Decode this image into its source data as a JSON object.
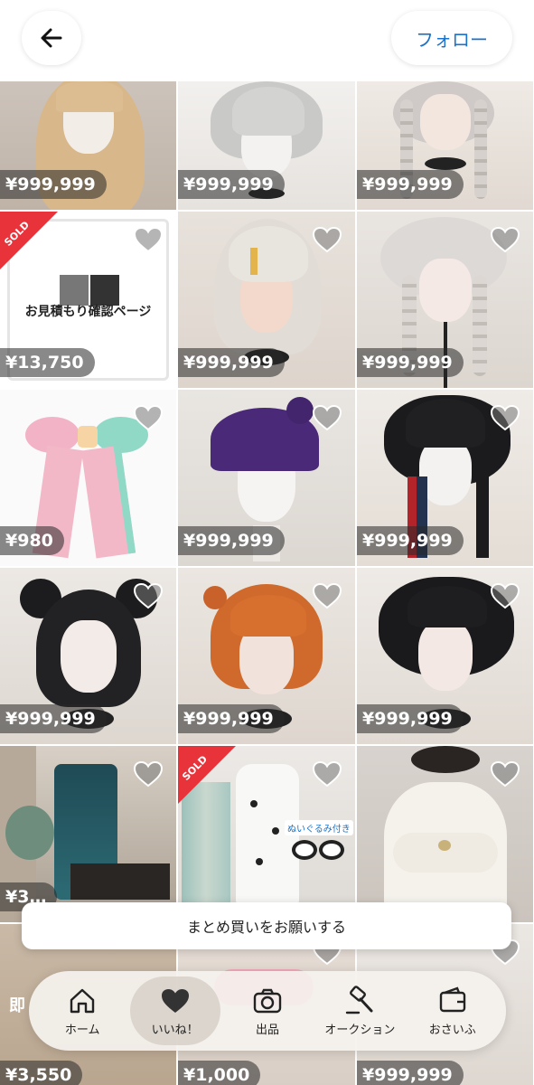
{
  "header": {
    "back_icon": "arrow-left-icon",
    "follow_label": "フォロー",
    "accent_color": "#1a73c8"
  },
  "items": [
    {
      "price": "¥999,999",
      "sold": false,
      "hair": "blonde-long"
    },
    {
      "price": "¥999,999",
      "sold": false,
      "hair": "silver-short"
    },
    {
      "price": "¥999,999",
      "sold": false,
      "hair": "silver-braids"
    },
    {
      "price": "¥13,750",
      "sold": true,
      "sold_label": "SOLD",
      "card_text": "お見積もり確認ページ"
    },
    {
      "price": "¥999,999",
      "sold": false,
      "hair": "platinum-shaggy"
    },
    {
      "price": "¥999,999",
      "sold": false,
      "hair": "white-braids"
    },
    {
      "price": "¥980",
      "sold": false,
      "hair": "ribbon"
    },
    {
      "price": "¥999,999",
      "sold": false,
      "hair": "purple-bob"
    },
    {
      "price": "¥999,999",
      "sold": false,
      "hair": "black-spiky"
    },
    {
      "price": "¥999,999",
      "sold": false,
      "hair": "black-buns"
    },
    {
      "price": "¥999,999",
      "sold": false,
      "hair": "orange-short"
    },
    {
      "price": "¥999,999",
      "sold": false,
      "hair": "black-curly"
    },
    {
      "price": "¥3…",
      "sold": false,
      "hair": "costume"
    },
    {
      "price": "",
      "sold": true,
      "sold_label": "SOLD",
      "tag": "ぬいぐるみ付き"
    },
    {
      "price": "",
      "sold": false,
      "hair": "white-shawl"
    },
    {
      "price": "¥3,550",
      "sold": false,
      "text": "即"
    },
    {
      "price": "¥1,000",
      "sold": false
    },
    {
      "price": "¥999,999",
      "sold": false
    }
  ],
  "banner": {
    "label": "まとめ買いをお願いする"
  },
  "tabs": [
    {
      "label": "ホーム",
      "icon": "home-icon",
      "active": false
    },
    {
      "label": "いいね！",
      "icon": "heart-icon",
      "active": true
    },
    {
      "label": "出品",
      "icon": "camera-icon",
      "active": false
    },
    {
      "label": "オークション",
      "icon": "gavel-icon",
      "active": false
    },
    {
      "label": "おさいふ",
      "icon": "wallet-icon",
      "active": false
    }
  ]
}
